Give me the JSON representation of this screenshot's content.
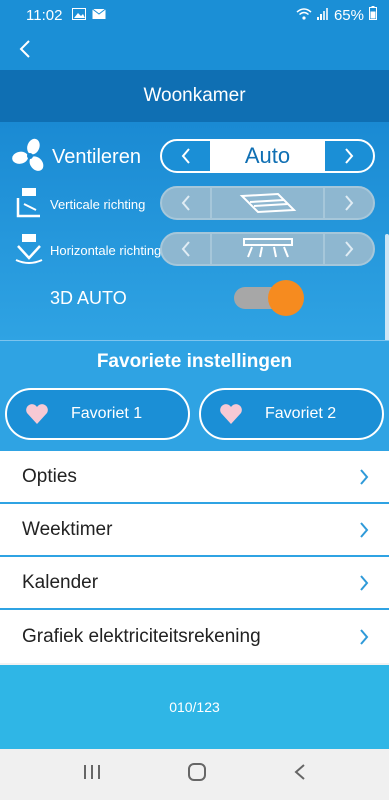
{
  "status": {
    "time": "11:02",
    "battery": "65%",
    "icons": [
      "image-icon",
      "message-icon",
      "wifi-icon",
      "signal-icon",
      "battery-icon"
    ]
  },
  "header": {
    "title": "Woonkamer"
  },
  "controls": {
    "fan": {
      "label": "Ventileren",
      "value": "Auto"
    },
    "vertical": {
      "label": "Verticale richting"
    },
    "horizontal": {
      "label": "Horizontale richting"
    },
    "auto3d": {
      "label": "3D AUTO",
      "on": true
    }
  },
  "favorites": {
    "title": "Favoriete instellingen",
    "items": [
      "Favoriet 1",
      "Favoriet 2"
    ]
  },
  "menu": [
    "Opties",
    "Weektimer",
    "Kalender",
    "Grafiek elektriciteitsrekening"
  ],
  "footer": {
    "code": "010/123"
  },
  "colors": {
    "primary": "#1b8fd6",
    "title_bar": "#0f6fb3",
    "accent_orange": "#f68b1f",
    "heart": "#f7c9d4",
    "chevron": "#2f9ad9"
  }
}
